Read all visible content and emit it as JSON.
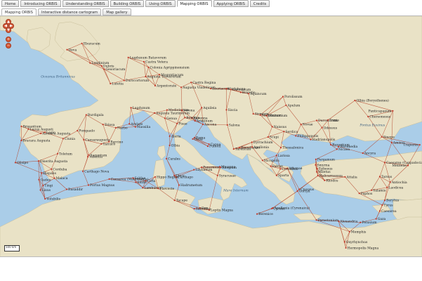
{
  "top_tabs": [
    {
      "label": "Home"
    },
    {
      "label": "Introducing ORBIS"
    },
    {
      "label": "Understanding ORBIS"
    },
    {
      "label": "Building ORBIS"
    },
    {
      "label": "Using ORBIS"
    },
    {
      "label": "Mapping ORBIS"
    },
    {
      "label": "Applying ORBIS"
    },
    {
      "label": "Credits"
    }
  ],
  "active_top_tab": 5,
  "sub_tabs": [
    {
      "label": "Mapping ORBIS"
    },
    {
      "label": "Interactive distance cartogram"
    },
    {
      "label": "Map gallery"
    }
  ],
  "active_sub_tab": 0,
  "map": {
    "controls": {
      "up": "▲",
      "down": "▼",
      "left": "◀",
      "right": "▶",
      "zoom_in": "+",
      "zoom_out": "−"
    },
    "scale_text": "500 km",
    "colors": {
      "sea": "#aacde8",
      "land": "#e9e2c6",
      "roads": "#b5452a",
      "sites": "#c0392b"
    },
    "places": [
      {
        "name": "Eburacum",
        "lon": -1.1,
        "lat": 54.0
      },
      {
        "name": "Deva",
        "lon": -2.9,
        "lat": 53.2
      },
      {
        "name": "Londinium",
        "lon": -0.1,
        "lat": 51.5
      },
      {
        "name": "Dubris",
        "lon": 1.3,
        "lat": 51.1
      },
      {
        "name": "Gesoriacum",
        "lon": 1.6,
        "lat": 50.7
      },
      {
        "name": "Lutetia",
        "lon": 2.35,
        "lat": 48.85
      },
      {
        "name": "Durocortorum",
        "lon": 4.0,
        "lat": 49.25
      },
      {
        "name": "Augusta Treverorum",
        "lon": 6.6,
        "lat": 49.75
      },
      {
        "name": "Colonia Agrippinensium",
        "lon": 6.95,
        "lat": 50.94
      },
      {
        "name": "Castra Vetera",
        "lon": 6.4,
        "lat": 51.65
      },
      {
        "name": "Lugdunum Batavorum",
        "lon": 4.5,
        "lat": 52.2
      },
      {
        "name": "Mogontiacum",
        "lon": 8.27,
        "lat": 50.0
      },
      {
        "name": "Argentorate",
        "lon": 7.75,
        "lat": 48.58
      },
      {
        "name": "Augusta Vindelicum",
        "lon": 10.9,
        "lat": 48.37
      },
      {
        "name": "Castra Regina",
        "lon": 12.1,
        "lat": 49.0
      },
      {
        "name": "Lauriacum",
        "lon": 14.47,
        "lat": 48.22
      },
      {
        "name": "Vindobona",
        "lon": 16.37,
        "lat": 48.2
      },
      {
        "name": "Carnuntum",
        "lon": 16.9,
        "lat": 48.1
      },
      {
        "name": "Brigetio",
        "lon": 18.1,
        "lat": 47.73
      },
      {
        "name": "Aquincum",
        "lon": 19.05,
        "lat": 47.56
      },
      {
        "name": "Lugdunum",
        "lon": 4.83,
        "lat": 45.76
      },
      {
        "name": "Burdigala",
        "lon": -0.58,
        "lat": 44.84
      },
      {
        "name": "Tolosa",
        "lon": 1.44,
        "lat": 43.6
      },
      {
        "name": "Narbo",
        "lon": 3.0,
        "lat": 43.18
      },
      {
        "name": "Arelate",
        "lon": 4.63,
        "lat": 43.68
      },
      {
        "name": "Massilia",
        "lon": 5.37,
        "lat": 43.3
      },
      {
        "name": "Genua",
        "lon": 8.93,
        "lat": 44.4
      },
      {
        "name": "Augusta Taurinorum",
        "lon": 7.68,
        "lat": 45.07
      },
      {
        "name": "Mediolanum",
        "lon": 9.19,
        "lat": 45.46
      },
      {
        "name": "Verona",
        "lon": 10.99,
        "lat": 45.44
      },
      {
        "name": "Aquileia",
        "lon": 13.37,
        "lat": 45.77
      },
      {
        "name": "Ravenna",
        "lon": 12.2,
        "lat": 44.42
      },
      {
        "name": "Bononia",
        "lon": 11.34,
        "lat": 44.49
      },
      {
        "name": "Pisae",
        "lon": 10.4,
        "lat": 43.72
      },
      {
        "name": "Ariminum",
        "lon": 12.57,
        "lat": 44.06
      },
      {
        "name": "Ancona",
        "lon": 13.52,
        "lat": 43.62
      },
      {
        "name": "Roma",
        "lon": 12.5,
        "lat": 41.9
      },
      {
        "name": "Ostia",
        "lon": 12.29,
        "lat": 41.75
      },
      {
        "name": "Capua",
        "lon": 14.25,
        "lat": 41.08
      },
      {
        "name": "Puteoli",
        "lon": 14.12,
        "lat": 40.82
      },
      {
        "name": "Brundisium",
        "lon": 17.94,
        "lat": 40.64
      },
      {
        "name": "Tarentum",
        "lon": 17.24,
        "lat": 40.46
      },
      {
        "name": "Rhegium",
        "lon": 15.65,
        "lat": 38.11
      },
      {
        "name": "Messana",
        "lon": 15.55,
        "lat": 38.19
      },
      {
        "name": "Syracusae",
        "lon": 15.29,
        "lat": 37.07
      },
      {
        "name": "Panormus",
        "lon": 13.36,
        "lat": 38.12
      },
      {
        "name": "Lilybaeum",
        "lon": 12.44,
        "lat": 37.8
      },
      {
        "name": "Carales",
        "lon": 9.11,
        "lat": 39.22
      },
      {
        "name": "Olbia",
        "lon": 9.5,
        "lat": 40.92
      },
      {
        "name": "Aleria",
        "lon": 9.51,
        "lat": 42.1
      },
      {
        "name": "Salona",
        "lon": 16.48,
        "lat": 43.54
      },
      {
        "name": "Siscia",
        "lon": 16.37,
        "lat": 45.48
      },
      {
        "name": "Sirmium",
        "lon": 19.61,
        "lat": 44.97
      },
      {
        "name": "Singidunum",
        "lon": 20.46,
        "lat": 44.82
      },
      {
        "name": "Viminacium",
        "lon": 21.22,
        "lat": 44.74
      },
      {
        "name": "Naissus",
        "lon": 21.9,
        "lat": 43.32
      },
      {
        "name": "Serdica",
        "lon": 23.32,
        "lat": 42.7
      },
      {
        "name": "Scupi",
        "lon": 21.4,
        "lat": 42.0
      },
      {
        "name": "Dyrrachium",
        "lon": 19.45,
        "lat": 41.32
      },
      {
        "name": "Apollonia",
        "lon": 19.47,
        "lat": 40.72
      },
      {
        "name": "Thessalonica",
        "lon": 22.94,
        "lat": 40.64
      },
      {
        "name": "Philippopolis",
        "lon": 24.75,
        "lat": 42.14
      },
      {
        "name": "Hadrianopolis",
        "lon": 26.56,
        "lat": 41.68
      },
      {
        "name": "Byzantium",
        "lon": 28.98,
        "lat": 41.01
      },
      {
        "name": "Durostorum",
        "lon": 27.27,
        "lat": 44.12
      },
      {
        "name": "Novae",
        "lon": 25.38,
        "lat": 43.61
      },
      {
        "name": "Odessus",
        "lon": 27.92,
        "lat": 43.2
      },
      {
        "name": "Tomis",
        "lon": 28.65,
        "lat": 44.17
      },
      {
        "name": "Apulum",
        "lon": 23.57,
        "lat": 46.07
      },
      {
        "name": "Porolissum",
        "lon": 23.2,
        "lat": 47.18
      },
      {
        "name": "Olbia (Borysthenes)",
        "lon": 31.9,
        "lat": 46.69
      },
      {
        "name": "Chersonesus",
        "lon": 33.49,
        "lat": 44.61
      },
      {
        "name": "Panticapaeum",
        "lon": 36.47,
        "lat": 45.35
      },
      {
        "name": "Sinope",
        "lon": 35.15,
        "lat": 42.02
      },
      {
        "name": "Amisus",
        "lon": 36.33,
        "lat": 41.29
      },
      {
        "name": "Trapezus",
        "lon": 39.72,
        "lat": 41.0
      },
      {
        "name": "Nicomedia",
        "lon": 29.92,
        "lat": 40.77
      },
      {
        "name": "Nicaea",
        "lon": 29.72,
        "lat": 40.43
      },
      {
        "name": "Ancyra",
        "lon": 32.85,
        "lat": 39.93
      },
      {
        "name": "Caesarea (Cappadocia)",
        "lon": 35.49,
        "lat": 38.73
      },
      {
        "name": "Melitene",
        "lon": 38.3,
        "lat": 38.35
      },
      {
        "name": "Pergamum",
        "lon": 27.18,
        "lat": 39.13
      },
      {
        "name": "Smyrna",
        "lon": 27.14,
        "lat": 38.42
      },
      {
        "name": "Ephesus",
        "lon": 27.34,
        "lat": 37.94
      },
      {
        "name": "Miletus",
        "lon": 27.28,
        "lat": 37.53
      },
      {
        "name": "Halicarnassus",
        "lon": 27.42,
        "lat": 37.04
      },
      {
        "name": "Rhodos",
        "lon": 28.22,
        "lat": 36.44
      },
      {
        "name": "Attalia",
        "lon": 30.7,
        "lat": 36.88
      },
      {
        "name": "Tarsus",
        "lon": 34.9,
        "lat": 36.92
      },
      {
        "name": "Antiochia",
        "lon": 36.16,
        "lat": 36.2
      },
      {
        "name": "Laodicea",
        "lon": 35.78,
        "lat": 35.52
      },
      {
        "name": "Salamis",
        "lon": 33.9,
        "lat": 35.18
      },
      {
        "name": "Paphos",
        "lon": 32.42,
        "lat": 34.77
      },
      {
        "name": "Berytus",
        "lon": 35.5,
        "lat": 33.89
      },
      {
        "name": "Tyrus",
        "lon": 35.2,
        "lat": 33.27
      },
      {
        "name": "Caesarea",
        "lon": 34.9,
        "lat": 32.5
      },
      {
        "name": "Gaza",
        "lon": 34.46,
        "lat": 31.5
      },
      {
        "name": "Pelusium",
        "lon": 32.57,
        "lat": 31.04
      },
      {
        "name": "Alexandria",
        "lon": 29.92,
        "lat": 31.2
      },
      {
        "name": "Memphis",
        "lon": 31.25,
        "lat": 29.85
      },
      {
        "name": "Oxyrhynchus",
        "lon": 30.65,
        "lat": 28.54
      },
      {
        "name": "Hermopolis Magna",
        "lon": 30.8,
        "lat": 27.78
      },
      {
        "name": "Paraetonium",
        "lon": 27.24,
        "lat": 31.35
      },
      {
        "name": "Apollonia (Cyrenaica)",
        "lon": 21.97,
        "lat": 32.9
      },
      {
        "name": "Cyrene",
        "lon": 21.86,
        "lat": 32.82
      },
      {
        "name": "Berenice",
        "lon": 20.07,
        "lat": 32.12
      },
      {
        "name": "Leptis Magna",
        "lon": 14.29,
        "lat": 32.64
      },
      {
        "name": "Oea",
        "lon": 13.18,
        "lat": 32.9
      },
      {
        "name": "Sabratha",
        "lon": 12.48,
        "lat": 32.8
      },
      {
        "name": "Tacape",
        "lon": 10.1,
        "lat": 33.88
      },
      {
        "name": "Hadrumetum",
        "lon": 10.64,
        "lat": 35.83
      },
      {
        "name": "Carthago",
        "lon": 10.32,
        "lat": 36.85
      },
      {
        "name": "Utica",
        "lon": 10.06,
        "lat": 37.06
      },
      {
        "name": "Hippo Regius",
        "lon": 7.75,
        "lat": 36.88
      },
      {
        "name": "Cirta",
        "lon": 6.61,
        "lat": 36.37
      },
      {
        "name": "Lambaesis",
        "lon": 6.26,
        "lat": 35.49
      },
      {
        "name": "Theveste",
        "lon": 8.12,
        "lat": 35.4
      },
      {
        "name": "Sitifis",
        "lon": 5.41,
        "lat": 36.19
      },
      {
        "name": "Saldae",
        "lon": 5.08,
        "lat": 36.75
      },
      {
        "name": "Caesarea (Mauretania)",
        "lon": 2.2,
        "lat": 36.6
      },
      {
        "name": "Tingi",
        "lon": -5.8,
        "lat": 35.78
      },
      {
        "name": "Volubilis",
        "lon": -5.55,
        "lat": 34.07
      },
      {
        "name": "Lixus",
        "lon": -6.11,
        "lat": 35.2
      },
      {
        "name": "Gades",
        "lon": -6.29,
        "lat": 36.53
      },
      {
        "name": "Hispalis",
        "lon": -5.98,
        "lat": 37.39
      },
      {
        "name": "Corduba",
        "lon": -4.78,
        "lat": 37.88
      },
      {
        "name": "Malaca",
        "lon": -4.42,
        "lat": 36.72
      },
      {
        "name": "Carthago Nova",
        "lon": -0.98,
        "lat": 37.6
      },
      {
        "name": "Valentia",
        "lon": -0.38,
        "lat": 39.47
      },
      {
        "name": "Saguntum",
        "lon": -0.27,
        "lat": 39.68
      },
      {
        "name": "Tarraco",
        "lon": 1.25,
        "lat": 41.12
      },
      {
        "name": "Barcino",
        "lon": 2.17,
        "lat": 41.39
      },
      {
        "name": "Caesaraugusta",
        "lon": -0.88,
        "lat": 41.65
      },
      {
        "name": "Toletum",
        "lon": -4.03,
        "lat": 39.86
      },
      {
        "name": "Emerita Augusta",
        "lon": -6.34,
        "lat": 38.92
      },
      {
        "name": "Olisipo",
        "lon": -9.14,
        "lat": 38.72
      },
      {
        "name": "Bracara Augusta",
        "lon": -8.43,
        "lat": 41.55
      },
      {
        "name": "Asturica Augusta",
        "lon": -6.06,
        "lat": 42.46
      },
      {
        "name": "Lucus Augusti",
        "lon": -7.56,
        "lat": 43.01
      },
      {
        "name": "Brigantium",
        "lon": -8.41,
        "lat": 43.37
      },
      {
        "name": "Legio",
        "lon": -5.57,
        "lat": 42.6
      },
      {
        "name": "Clunia",
        "lon": -3.37,
        "lat": 41.78
      },
      {
        "name": "Pompaelo",
        "lon": -1.64,
        "lat": 42.81
      },
      {
        "name": "Portus Magnus",
        "lon": -0.31,
        "lat": 35.83
      },
      {
        "name": "Rusaddir",
        "lon": -2.94,
        "lat": 35.29
      },
      {
        "name": "Athenae",
        "lon": 23.73,
        "lat": 37.98
      },
      {
        "name": "Corinthus",
        "lon": 22.88,
        "lat": 37.91
      },
      {
        "name": "Patrae",
        "lon": 21.73,
        "lat": 38.25
      },
      {
        "name": "Nicopolis",
        "lon": 20.73,
        "lat": 39.0
      },
      {
        "name": "Gortyn",
        "lon": 24.95,
        "lat": 35.06
      },
      {
        "name": "Cnossus",
        "lon": 25.16,
        "lat": 35.3
      },
      {
        "name": "Larissa",
        "lon": 22.42,
        "lat": 39.64
      },
      {
        "name": "Sparta",
        "lon": 22.43,
        "lat": 37.08
      }
    ],
    "seas": [
      {
        "name": "Oceanus Britannicus",
        "lon": -4.0,
        "lat": 49.6
      },
      {
        "name": "Mare Internum",
        "lon": 17.5,
        "lat": 35.0
      },
      {
        "name": "Pontus Euxinus",
        "lon": 34.0,
        "lat": 43.4
      }
    ]
  }
}
